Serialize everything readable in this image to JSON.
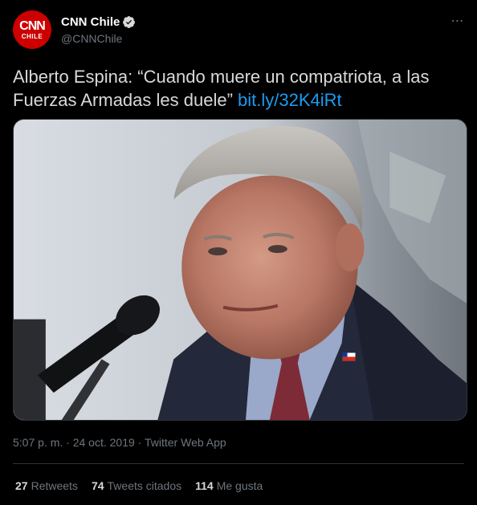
{
  "header": {
    "avatar_logo_main": "CNN",
    "avatar_logo_sub": "CHILE",
    "display_name": "CNN Chile",
    "handle": "@CNNChile",
    "more_icon": "more-horizontal-icon",
    "verified_icon": "verified-badge-icon"
  },
  "tweet": {
    "text": "Alberto Espina: “Cuando muere un compatriota, a las Fuerzas Armadas les duele”",
    "link": "bit.ly/32K4iRt"
  },
  "meta": {
    "time": "5:07 p. m.",
    "separator_1": " · ",
    "date": "24 oct. 2019",
    "separator_2": " · ",
    "source": "Twitter Web App"
  },
  "stats": {
    "retweets_count": "27",
    "retweets_label": "Retweets",
    "quotes_count": "74",
    "quotes_label": "Tweets citados",
    "likes_count": "114",
    "likes_label": "Me gusta"
  },
  "colors": {
    "background": "#000000",
    "text": "#d9d9d9",
    "secondary_text": "#6e767d",
    "link": "#1d9bf0",
    "brand_red": "#cc0000",
    "verified": "#d9d9d9"
  }
}
